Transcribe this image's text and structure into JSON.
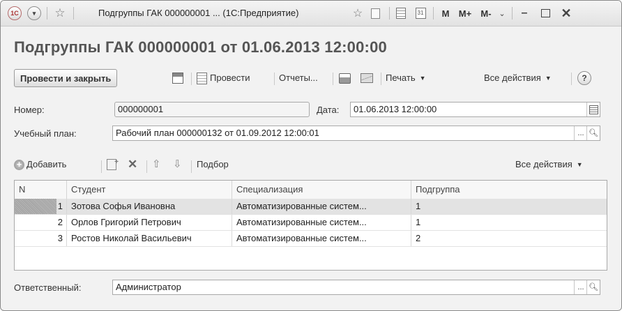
{
  "window": {
    "title": "Подгруппы ГАК 000000001 ... (1С:Предприятие)",
    "logo_text": "1С",
    "m_buttons": [
      "M",
      "M+",
      "M-"
    ]
  },
  "document": {
    "title": "Подгруппы ГАК 000000001 от 01.06.2013 12:00:00"
  },
  "toolbar": {
    "post_close": "Провести и закрыть",
    "post": "Провести",
    "reports": "Отчеты...",
    "print": "Печать",
    "all_actions": "Все действия",
    "help": "?"
  },
  "fields": {
    "number_label": "Номер:",
    "number_value": "000000001",
    "date_label": "Дата:",
    "date_value": "01.06.2013 12:00:00",
    "plan_label": "Учебный план:",
    "plan_value": "Рабочий план 000000132 от 01.09.2012 12:00:01",
    "responsible_label": "Ответственный:",
    "responsible_value": "Администратор"
  },
  "table_toolbar": {
    "add": "Добавить",
    "pick": "Подбор",
    "all_actions": "Все действия"
  },
  "table": {
    "columns": [
      "N",
      "Студент",
      "Специализация",
      "Подгруппа"
    ],
    "rows": [
      {
        "n": "1",
        "student": "Зотова Софья Ивановна",
        "spec": "Автоматизированные систем...",
        "subgroup": "1"
      },
      {
        "n": "2",
        "student": "Орлов Григорий Петрович",
        "spec": "Автоматизированные систем...",
        "subgroup": "1"
      },
      {
        "n": "3",
        "student": "Ростов Николай Васильевич",
        "spec": "Автоматизированные систем...",
        "subgroup": "2"
      }
    ],
    "selected_row": 1
  },
  "pick_button": "..."
}
